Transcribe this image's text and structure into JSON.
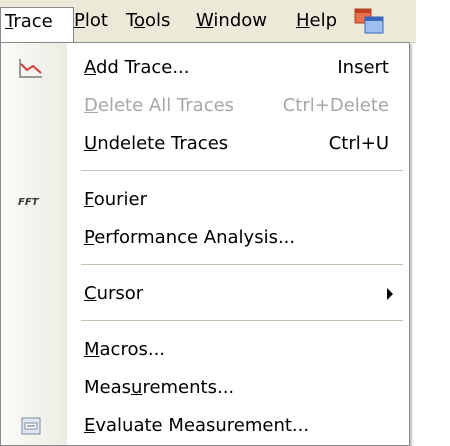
{
  "menubar": {
    "items": [
      {
        "label": "Trace",
        "mnemonic_index": 0
      },
      {
        "label": "Plot",
        "mnemonic_index": 0
      },
      {
        "label": "Tools",
        "mnemonic_index": 1
      },
      {
        "label": "Window",
        "mnemonic_index": 0
      },
      {
        "label": "Help",
        "mnemonic_index": 0
      }
    ],
    "app_icon": "restore-window-icon"
  },
  "trace_menu": {
    "items": [
      {
        "label": "Add Trace...",
        "shortcut": "Insert",
        "enabled": true,
        "icon": "add-trace-icon"
      },
      {
        "label": "Delete All Traces",
        "shortcut": "Ctrl+Delete",
        "enabled": false
      },
      {
        "label": "Undelete Traces",
        "shortcut": "Ctrl+U",
        "enabled": true
      },
      {
        "label": "Fourier",
        "shortcut": "",
        "enabled": true,
        "icon": "fft-icon",
        "icon_text": "FFT"
      },
      {
        "label": "Performance Analysis...",
        "shortcut": "",
        "enabled": true
      },
      {
        "label": "Cursor",
        "shortcut": "",
        "enabled": true,
        "submenu": true
      },
      {
        "label": "Macros...",
        "shortcut": "",
        "enabled": true
      },
      {
        "label": "Measurements...",
        "shortcut": "",
        "enabled": true
      },
      {
        "label": "Evaluate Measurement...",
        "shortcut": "",
        "enabled": true,
        "icon": "evaluate-measurement-icon"
      }
    ]
  },
  "colors": {
    "menubar_bg": "#ece9d8",
    "selection_blue": "#316ac5",
    "disabled_text": "#a7a6aa"
  }
}
